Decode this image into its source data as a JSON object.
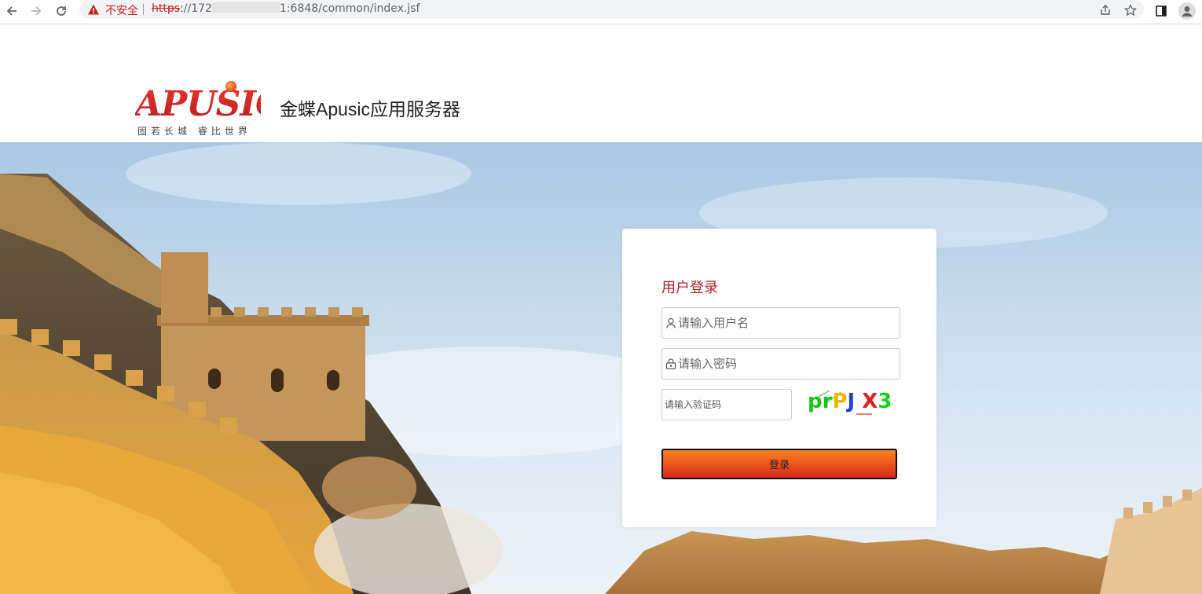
{
  "browser": {
    "security_label": "不安全",
    "url_scheme": "https",
    "url_rest_prefix": "://172",
    "url_rest_suffix": "1:6848/common/index.jsf",
    "back_icon": "arrow-left-icon",
    "forward_icon": "arrow-right-icon",
    "reload_icon": "reload-icon",
    "share_icon": "share-icon",
    "bookmark_icon": "star-icon",
    "sidepanel_icon": "side-panel-icon",
    "profile_icon": "profile-avatar-icon"
  },
  "header": {
    "logo_text": "APUSIC",
    "logo_tagline": "固若长城 睿比世界",
    "title": "金蝶Apusic应用服务器"
  },
  "login": {
    "title": "用户登录",
    "username_placeholder": "请输入用户名",
    "password_placeholder": "请输入密码",
    "captcha_placeholder": "请输入验证码",
    "captcha_text": "prPJX3",
    "submit_label": "登录"
  },
  "colors": {
    "accent_red": "#b2222e",
    "button_top": "#f6821f",
    "button_bottom": "#d42a1e",
    "insecure_red": "#c5221f"
  }
}
